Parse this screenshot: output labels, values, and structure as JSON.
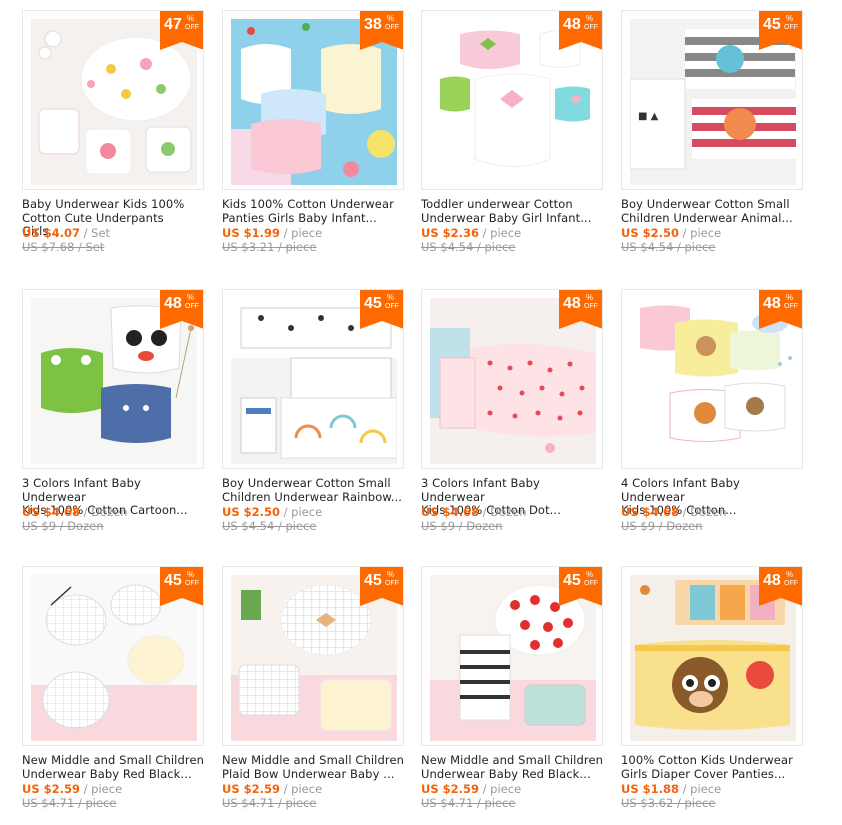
{
  "colors": {
    "accent": "#f5620a",
    "badge": "#ff6a00",
    "text": "#222222",
    "muted": "#999999"
  },
  "badge": {
    "off_label": "OFF",
    "percent": "%"
  },
  "products": [
    {
      "discount": "47",
      "title_l1": "Baby Underwear Kids 100%",
      "title_l2": "Cotton Cute Underpants Girls...",
      "price": "US $4.07",
      "unit": " / Set",
      "old": "US $7.68 / Set",
      "theme": "fruit"
    },
    {
      "discount": "38",
      "title_l1": "Kids 100% Cotton Underwear",
      "title_l2": "Panties Girls Baby Infant...",
      "price": "US $1.99",
      "unit": " / piece",
      "old": "US $3.21 / piece",
      "theme": "pastel"
    },
    {
      "discount": "48",
      "title_l1": "Toddler underwear Cotton",
      "title_l2": "Underwear Baby Girl Infant...",
      "price": "US $2.36",
      "unit": " / piece",
      "old": "US $4.54 / piece",
      "theme": "bows"
    },
    {
      "discount": "45",
      "title_l1": "Boy Underwear Cotton Small",
      "title_l2": "Children Underwear Animal...",
      "price": "US $2.50",
      "unit": " / piece",
      "old": "US $4.54 / piece",
      "theme": "stripes"
    },
    {
      "discount": "48",
      "title_l1": "3 Colors Infant Baby Underwear",
      "title_l2": "Kids 100% Cotton Cartoon...",
      "price": "US $4.68",
      "unit": " / Dozen",
      "old": "US $9 / Dozen",
      "theme": "cartoon"
    },
    {
      "discount": "45",
      "title_l1": "Boy Underwear Cotton Small",
      "title_l2": "Children Underwear Rainbow...",
      "price": "US $2.50",
      "unit": " / piece",
      "old": "US $4.54 / piece",
      "theme": "rainbow"
    },
    {
      "discount": "48",
      "title_l1": "3 Colors Infant Baby Underwear",
      "title_l2": "Kids 100% Cotton Dot...",
      "price": "US $4.68",
      "unit": " / Dozen",
      "old": "US $9 / Dozen",
      "theme": "dots"
    },
    {
      "discount": "48",
      "title_l1": "4 Colors Infant Baby Underwear",
      "title_l2": "Kids 100% Cotton...",
      "price": "US $4.68",
      "unit": " / Dozen",
      "old": "US $9 / Dozen",
      "theme": "animals"
    },
    {
      "discount": "45",
      "title_l1": "New Middle and Small Children",
      "title_l2": "Underwear Baby Red Black...",
      "price": "US $2.59",
      "unit": " / piece",
      "old": "US $4.71 / piece",
      "theme": "plaid"
    },
    {
      "discount": "45",
      "title_l1": "New Middle and Small Children",
      "title_l2": "Plaid Bow Underwear Baby ...",
      "price": "US $2.59",
      "unit": " / piece",
      "old": "US $4.71 / piece",
      "theme": "plaidbow"
    },
    {
      "discount": "45",
      "title_l1": "New Middle and Small Children",
      "title_l2": "Underwear Baby Red Black...",
      "price": "US $2.59",
      "unit": " / piece",
      "old": "US $4.71 / piece",
      "theme": "reddots"
    },
    {
      "discount": "48",
      "title_l1": "100% Cotton Kids Underwear",
      "title_l2": "Girls Diaper Cover Panties...",
      "price": "US $1.88",
      "unit": " / piece",
      "old": "US $3.62 / piece",
      "theme": "monkey"
    }
  ]
}
